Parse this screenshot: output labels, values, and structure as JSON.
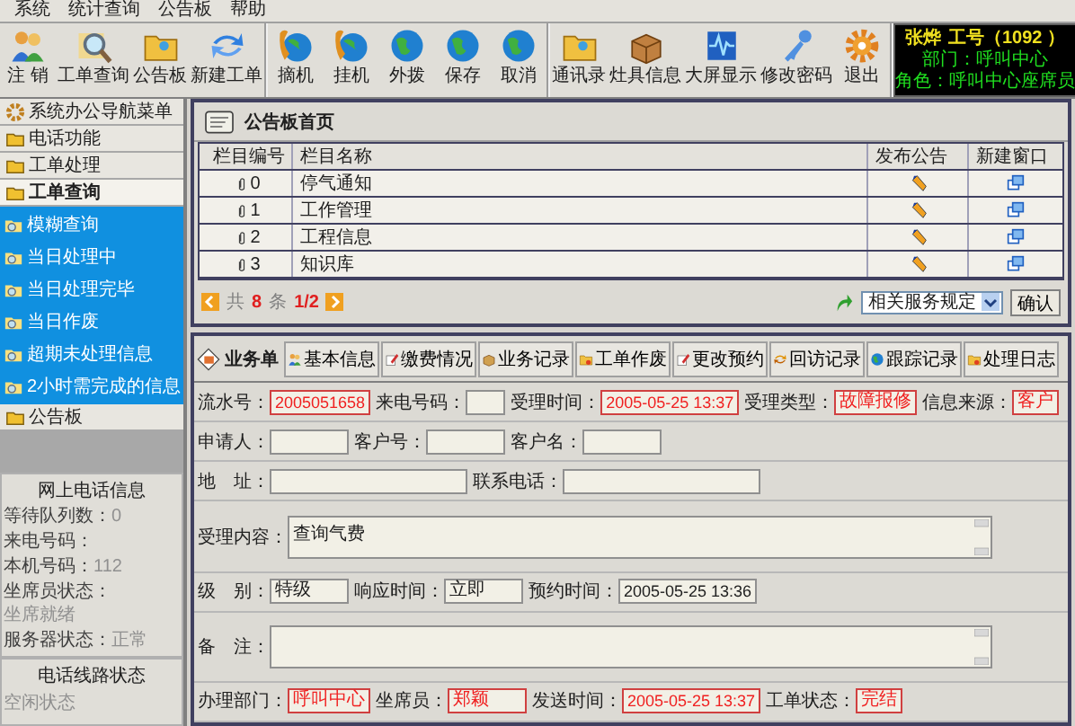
{
  "menu_bar": [
    "系统",
    "统计查询",
    "公告板",
    "帮助"
  ],
  "toolbar": {
    "groups": [
      [
        "注 销",
        "工单查询",
        "公告板",
        "新建工单"
      ],
      [
        "摘机",
        "挂机",
        "外拨",
        "保存",
        "取消"
      ],
      [
        "通讯录",
        "灶具信息",
        "大屏显示",
        "修改密码",
        "退出"
      ]
    ]
  },
  "user_panel": {
    "name": "张烨",
    "staff_id": "工号（1092 ）",
    "department": "部门：呼叫中心",
    "role": "角色：呼叫中心座席员"
  },
  "sidebar": {
    "title": "系统办公导航菜单",
    "sections": [
      {
        "label": "电话功能",
        "expanded": false
      },
      {
        "label": "工单处理",
        "expanded": false
      },
      {
        "label": "工单查询",
        "expanded": true,
        "children": [
          "模糊查询",
          "当日处理中",
          "当日处理完毕",
          "当日作废",
          "超期未处理信息",
          "2小时需完成的信息"
        ]
      },
      {
        "label": "公告板",
        "expanded": false
      }
    ]
  },
  "phone_info": {
    "title": "网上电话信息",
    "rows": [
      {
        "label": "等待队列数：",
        "value": "0"
      },
      {
        "label": "来电号码："
      },
      {
        "label": "本机号码：",
        "value": "112"
      },
      {
        "label": "坐席员状态：",
        "value": "坐席就绪"
      },
      {
        "label": "服务器状态：",
        "value": "正常"
      }
    ]
  },
  "line_status": {
    "title": "电话线路状态",
    "value": "空闲状态"
  },
  "bulletin": {
    "title": "公告板首页",
    "columns": [
      "栏目编号",
      "栏目名称",
      "发布公告",
      "新建窗口"
    ],
    "rows": [
      {
        "id": "0",
        "name": "停气通知"
      },
      {
        "id": "1",
        "name": "工作管理"
      },
      {
        "id": "2",
        "name": "工程信息"
      },
      {
        "id": "3",
        "name": "知识库"
      }
    ],
    "pager": {
      "prefix": "共",
      "count": "8",
      "unit": "条",
      "page": "1/2"
    },
    "service_select": "相关服务规定",
    "confirm": "确认"
  },
  "work_order": {
    "title": "业务单",
    "tabs": [
      "基本信息",
      "缴费情况",
      "业务记录",
      "工单作废",
      "更改预约",
      "回访记录",
      "跟踪记录",
      "处理日志"
    ],
    "rows": [
      [
        {
          "label": "流水号：",
          "value": "2005051658",
          "kind": "serial",
          "highlight": true
        },
        {
          "label": "来电号码：",
          "kind": "tiny",
          "highlight": false
        },
        {
          "label": "受理时间：",
          "value": "2005-05-25 13:37",
          "kind": "date",
          "highlight": true
        },
        {
          "label": "受理类型：",
          "value": "故障报修",
          "kind": "text",
          "highlight": true
        },
        {
          "label": "信息来源：",
          "value": "客户",
          "kind": "tiny",
          "highlight": true
        }
      ],
      [
        {
          "label": "申请人：",
          "kind": "text",
          "highlight": false
        },
        {
          "label": "客户号：",
          "kind": "text",
          "highlight": false
        },
        {
          "label": "客户名：",
          "kind": "text",
          "highlight": false
        }
      ],
      [
        {
          "label": "地　址：",
          "kind": "wide",
          "highlight": false
        },
        {
          "label": "联系电话：",
          "kind": "wide",
          "highlight": false
        }
      ],
      [
        {
          "label": "受理内容：",
          "value": "查询气费",
          "kind": "textarea",
          "highlight": false
        }
      ],
      [
        {
          "label": "级　别：",
          "value": "特级",
          "kind": "text",
          "highlight": false
        },
        {
          "label": "响应时间：",
          "value": "立即",
          "kind": "text",
          "highlight": false
        },
        {
          "label": "预约时间：",
          "value": "2005-05-25 13:36",
          "kind": "date",
          "highlight": false
        }
      ],
      [
        {
          "label": "备　注：",
          "kind": "textarea",
          "highlight": false
        }
      ],
      [
        {
          "label": "办理部门：",
          "value": "呼叫中心",
          "kind": "text",
          "highlight": true
        },
        {
          "label": "坐席员：",
          "value": "郑颖",
          "kind": "text",
          "highlight": true
        },
        {
          "label": "发送时间：",
          "value": "2005-05-25 13:37",
          "kind": "date",
          "highlight": true
        },
        {
          "label": "工单状态：",
          "value": "完结",
          "kind": "tiny",
          "highlight": true
        }
      ]
    ]
  }
}
